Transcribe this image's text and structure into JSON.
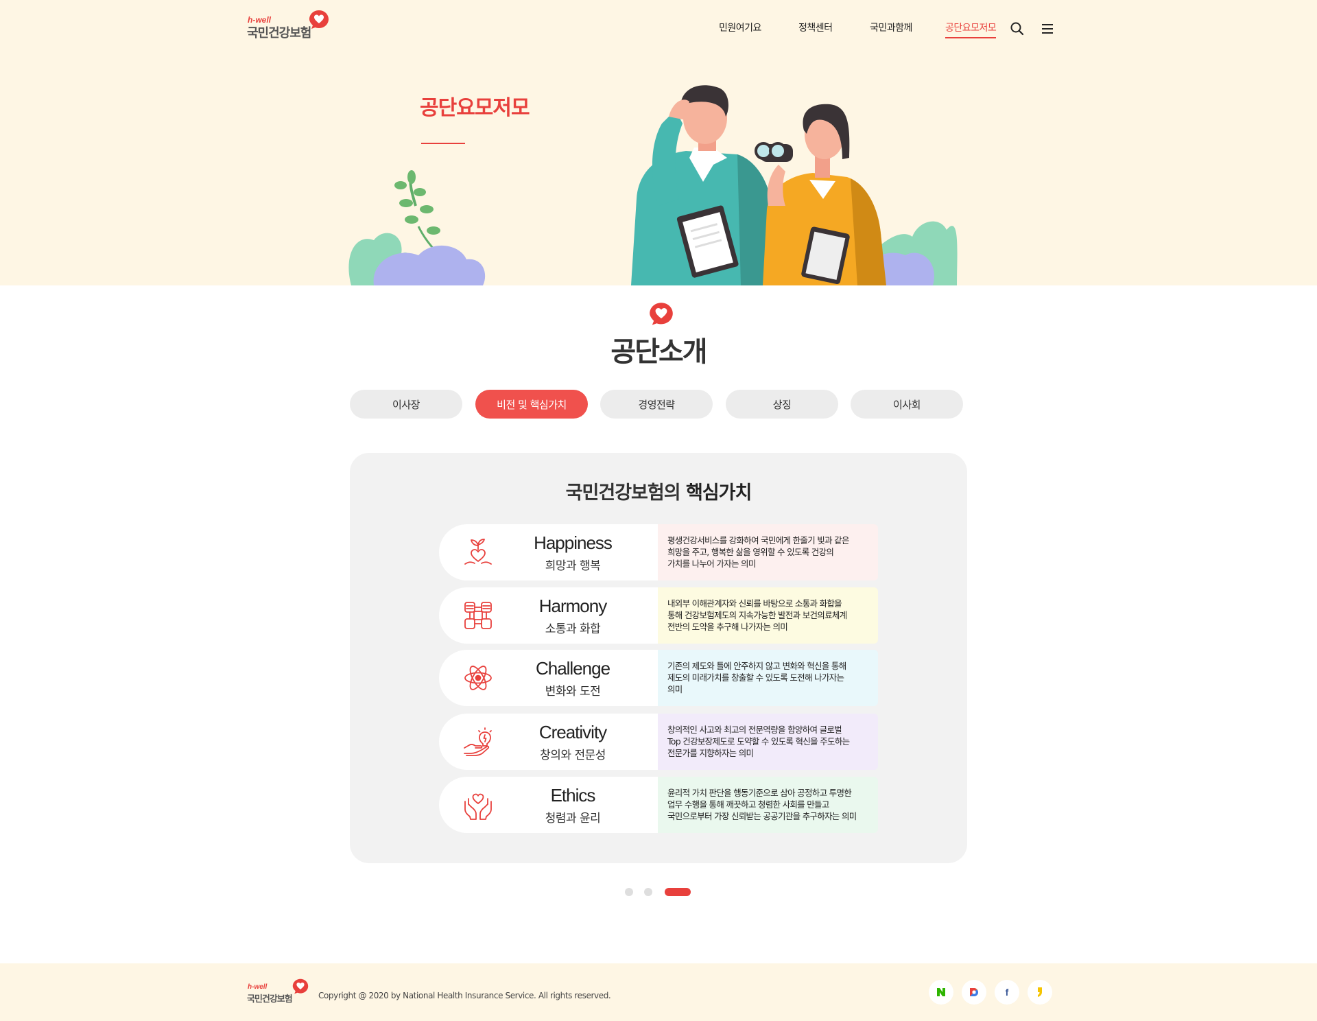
{
  "brand": {
    "logo_sub": "h-well",
    "logo_main": "국민건강보험"
  },
  "nav": {
    "items": [
      "민원여기요",
      "정책센터",
      "국민과함께",
      "공단요모저모"
    ],
    "active_index": 3,
    "icons": [
      "search-icon",
      "menu-icon"
    ]
  },
  "hero": {
    "title": "공단요모저모"
  },
  "section": {
    "title": "공단소개"
  },
  "tabs": {
    "items": [
      "이사장",
      "비전 및 핵심가치",
      "경영전략",
      "상징",
      "이사회"
    ],
    "active_index": 1
  },
  "card": {
    "heading_normal": "국민건강보험의 ",
    "heading_bold": "핵심가치",
    "values": [
      {
        "en": "Happiness",
        "ko": "희망과 행복",
        "icon": "sprout-heart-icon",
        "desc": "평생건강서비스를 강화하여 국민에게 한줄기 빛과 같은\n희망을 주고, 행복한 삶을 영위할 수 있도록 건강의\n가치를 나누어 가자는 의미",
        "color": "#fdf0ef"
      },
      {
        "en": "Harmony",
        "ko": "소통과 화합",
        "icon": "joined-hands-icon",
        "desc": "내외부 이해관계자와 신뢰를 바탕으로 소통과 화합을\n통해 건강보험제도의 지속가능한 발전과 보건의료체계\n전반의 도약을 추구해 나가자는 의미",
        "color": "#fdfbe1"
      },
      {
        "en": "Challenge",
        "ko": "변화와 도전",
        "icon": "atom-icon",
        "desc": "기존의 제도와 틀에 안주하지 않고 변화와 혁신을 통해\n제도의 미래가치를 창출할 수 있도록 도전해 나가자는\n의미",
        "color": "#e9f8fb"
      },
      {
        "en": "Creativity",
        "ko": "창의와 전문성",
        "icon": "hand-lightbulb-icon",
        "desc": "창의적인 사고와 최고의 전문역량을 함양하여 글로벌\nTop 건강보장제도로 도약할 수 있도록 혁신을 주도하는\n전문가를 지향하자는 의미",
        "color": "#f2ebfa"
      },
      {
        "en": "Ethics",
        "ko": "청렴과 윤리",
        "icon": "hands-heart-icon",
        "desc": "윤리적 가치 판단을 행동기준으로 삼아 공정하고 투명한\n업무 수행을 통해 깨끗하고 청렴한 사회를 만들고\n국민으로부터 가장 신뢰받는 공공기관을 추구하자는 의미",
        "color": "#eaf8ee"
      }
    ]
  },
  "pager": {
    "count": 3,
    "active_index": 2
  },
  "footer": {
    "logo_sub": "h-well",
    "logo_main": "국민건강보험",
    "copyright": "Copyright @ 2020 by National Health Insurance Service. All rights reserved.",
    "sns": [
      {
        "name": "naver-blog-icon",
        "glyph": "N",
        "color": "#2db400"
      },
      {
        "name": "daum-icon",
        "glyph": "D",
        "color": "#8a6cf0"
      },
      {
        "name": "facebook-icon",
        "glyph": "f",
        "color": "#3b5998"
      },
      {
        "name": "kakao-story-icon",
        "glyph": "❜",
        "color": "#f5c400"
      }
    ]
  },
  "colors": {
    "accent": "#e8403c",
    "hero_bg": "#fef6e4",
    "tab_bg": "#ececec",
    "card_bg": "#f2f2f2"
  }
}
